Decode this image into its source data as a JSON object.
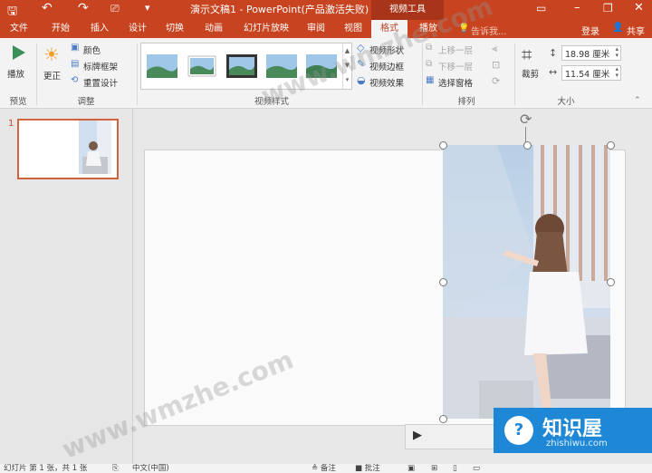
{
  "titlebar": {
    "title": "演示文稿1 - PowerPoint(产品激活失败)",
    "context_tab": "视频工具",
    "login": "登录",
    "share": "共享"
  },
  "tabs": [
    "文件",
    "开始",
    "插入",
    "设计",
    "切换",
    "动画",
    "幻灯片放映",
    "审阅",
    "视图",
    "格式",
    "播放"
  ],
  "tell_me": "告诉我...",
  "ribbon": {
    "play_label": "播放",
    "preview_group": "预览",
    "correct_label": "更正",
    "color_label": "颜色",
    "poster_label": "标牌框架",
    "reset_label": "重置设计",
    "adjust_group": "调整",
    "styles_group": "视频样式",
    "shape_label": "视频形状",
    "border_label": "视频边框",
    "effects_label": "视频效果",
    "bring_forward": "上移一层",
    "send_backward": "下移一层",
    "selection_pane": "选择窗格",
    "arrange_group": "排列",
    "crop_label": "裁剪",
    "height_value": "18.98 厘米",
    "width_value": "11.54 厘米",
    "size_group": "大小"
  },
  "slides": {
    "number": "1"
  },
  "status": {
    "slide_info": "幻灯片 第 1 张，共 1 张",
    "language": "中文(中国)",
    "notes": "备注",
    "comments": "批注"
  },
  "watermark": "www.wmzhe.com",
  "brand": {
    "name": "知识屋",
    "url": "zhishiwu.com"
  },
  "colors": {
    "accent": "#c8431f",
    "active_tab_text": "#b7472a"
  }
}
